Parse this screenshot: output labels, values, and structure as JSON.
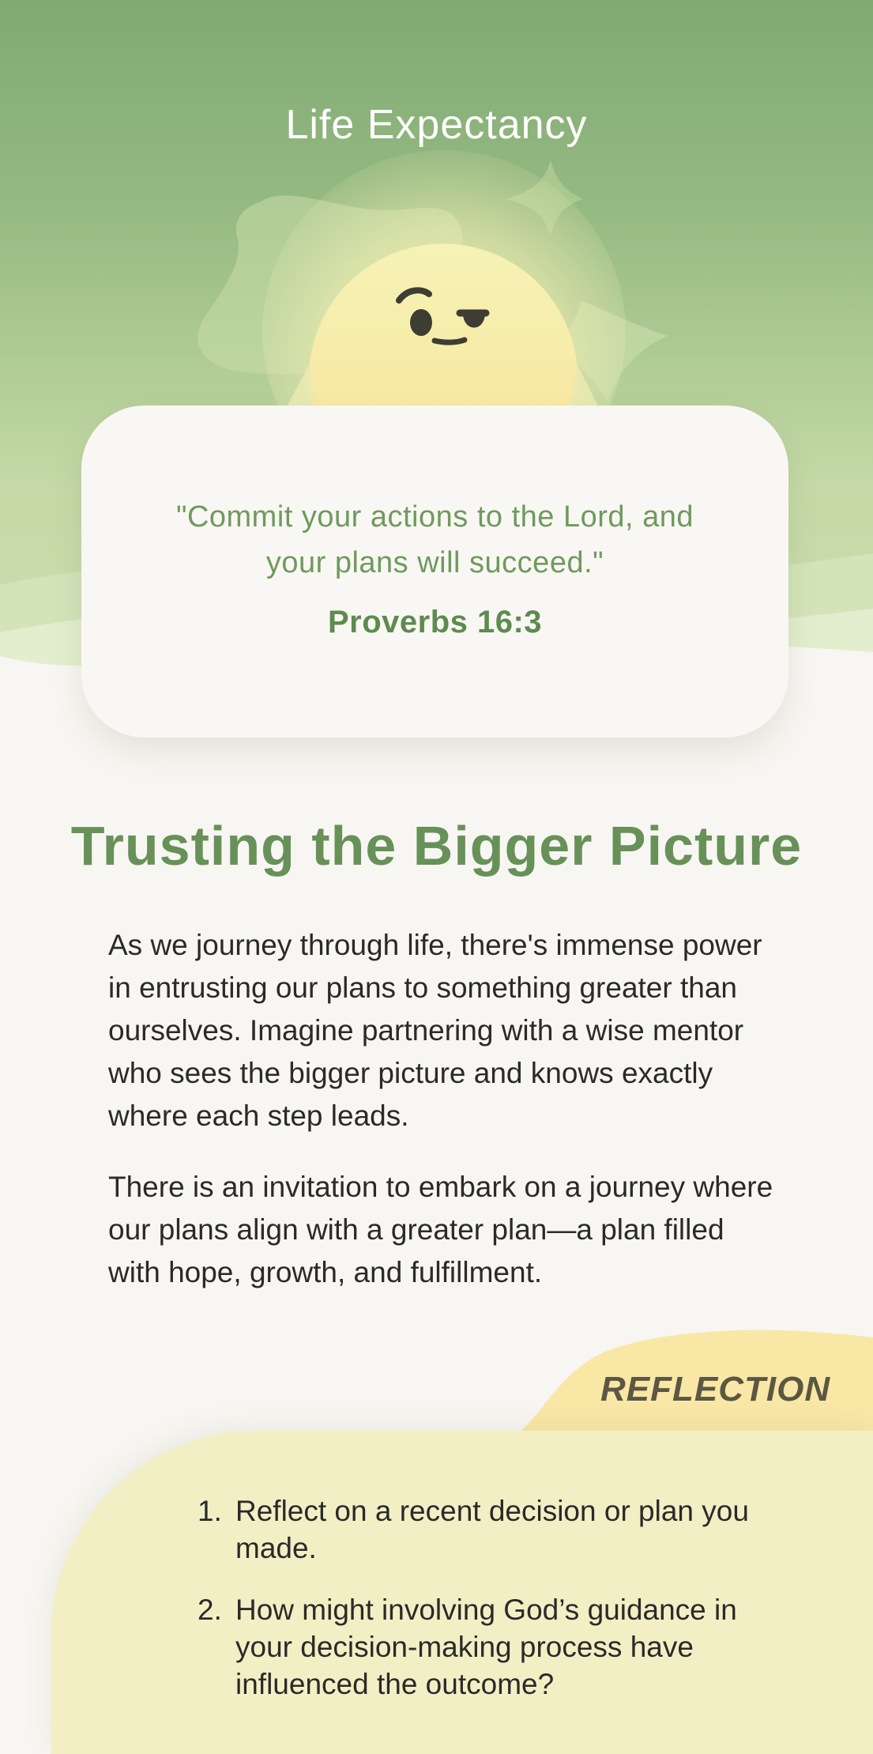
{
  "header": {
    "title": "Life Expectancy"
  },
  "hero": {
    "mascot": "sun-face-icon",
    "sparkle": "sparkle-icon"
  },
  "quote": {
    "text": "\"Commit your actions to the Lord, and your plans will succeed.\"",
    "reference": "Proverbs 16:3"
  },
  "article": {
    "title": "Trusting the Bigger Picture",
    "paragraphs": [
      "As we journey through life, there's immense power in entrusting our plans to something greater than ourselves. Imagine partnering with a wise mentor who sees the bigger picture and knows exactly where each step leads.",
      "There is an invitation to embark on a journey where our plans align with a greater plan—a plan filled with hope, growth, and fulfillment."
    ]
  },
  "reflection": {
    "label": "REFLECTION",
    "items": [
      {
        "num": "1.",
        "text": "Reflect on a recent decision or plan you made."
      },
      {
        "num": "2.",
        "text": "How might involving God’s guidance in your decision-making process have influenced the outcome?"
      }
    ]
  },
  "colors": {
    "accent_green": "#679158",
    "hero_top": "#80aa72",
    "hero_bottom": "#d4e4b6",
    "sun": "#f6efa8",
    "reflection_tab": "#f9e7a6",
    "reflection_panel": "#f3efc5",
    "background": "#f8f6f2"
  }
}
